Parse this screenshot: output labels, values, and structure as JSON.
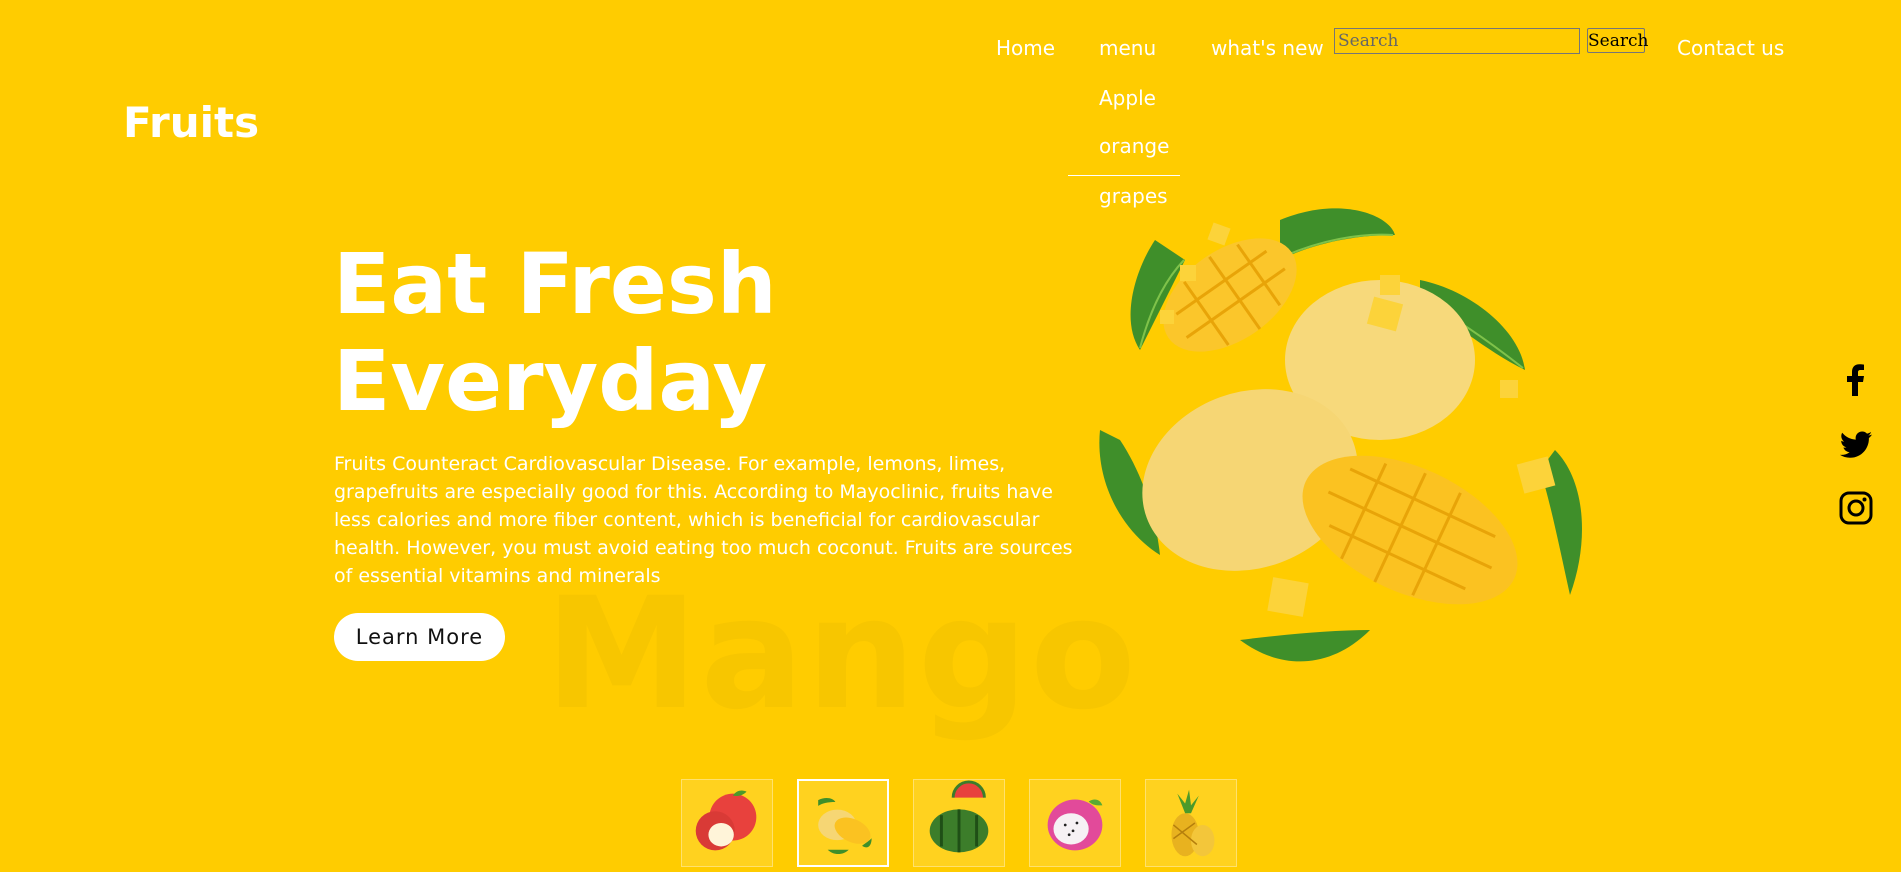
{
  "brand": {
    "logo_text": "Fruits"
  },
  "nav": {
    "home": "Home",
    "menu": "menu",
    "whats_new": "what's new",
    "contact": "Contact us",
    "dropdown": [
      "Apple",
      "orange",
      "grapes"
    ]
  },
  "search": {
    "placeholder": "Search",
    "button_label": "Search"
  },
  "hero": {
    "title_line1": "Eat Fresh",
    "title_line2": "Everyday",
    "paragraph": "Fruits Counteract Cardiovascular Disease. For example, lemons, limes, grapefruits are especially good for this. According to Mayoclinic, fruits have less calories and more fiber content, which is beneficial for cardiovascular health. However, you must avoid eating too much coconut. Fruits are sources of essential vitamins and minerals",
    "button_label": "Learn More",
    "watermark": "Mango",
    "image": "mango-slices-with-leaves"
  },
  "social": [
    {
      "icon": "facebook-icon"
    },
    {
      "icon": "twitter-icon"
    },
    {
      "icon": "instagram-icon"
    }
  ],
  "thumbnails": [
    {
      "fruit": "apple",
      "active": false
    },
    {
      "fruit": "mango",
      "active": true
    },
    {
      "fruit": "watermelon",
      "active": false
    },
    {
      "fruit": "dragon-fruit",
      "active": false
    },
    {
      "fruit": "pineapple",
      "active": false
    }
  ],
  "colors": {
    "background": "#ffcc00",
    "text": "#ffffff",
    "button_bg": "#ffffff"
  }
}
